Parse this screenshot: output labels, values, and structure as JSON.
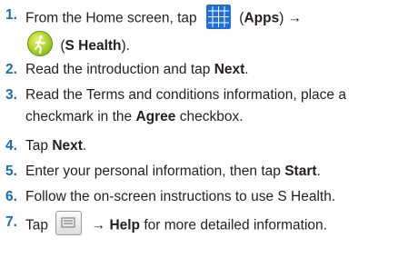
{
  "steps": [
    {
      "num": "1.",
      "parts": {
        "a": "From the Home screen, tap",
        "b": "(",
        "c": "Apps",
        "d": ") →",
        "e": "(",
        "f": "S Health",
        "g": ")."
      }
    },
    {
      "num": "2.",
      "parts": {
        "a": "Read the introduction and tap ",
        "b": "Next",
        "c": "."
      }
    },
    {
      "num": "3.",
      "line1": "Read the Terms and conditions information, place a",
      "parts": {
        "a": "checkmark in the ",
        "b": "Agree",
        "c": " checkbox."
      }
    },
    {
      "num": "4.",
      "parts": {
        "a": "Tap ",
        "b": "Next",
        "c": "."
      }
    },
    {
      "num": "5.",
      "parts": {
        "a": "Enter your personal information, then tap ",
        "b": "Start",
        "c": "."
      }
    },
    {
      "num": "6.",
      "parts": {
        "a": "Follow the on-screen instructions to use S Health."
      }
    },
    {
      "num": "7.",
      "parts": {
        "a": "Tap",
        "b": "→ ",
        "c": "Help",
        "d": " for more detailed information."
      }
    }
  ],
  "icons": {
    "apps": "apps-grid-icon",
    "health": "s-health-icon",
    "menu": "menu-key-icon"
  }
}
